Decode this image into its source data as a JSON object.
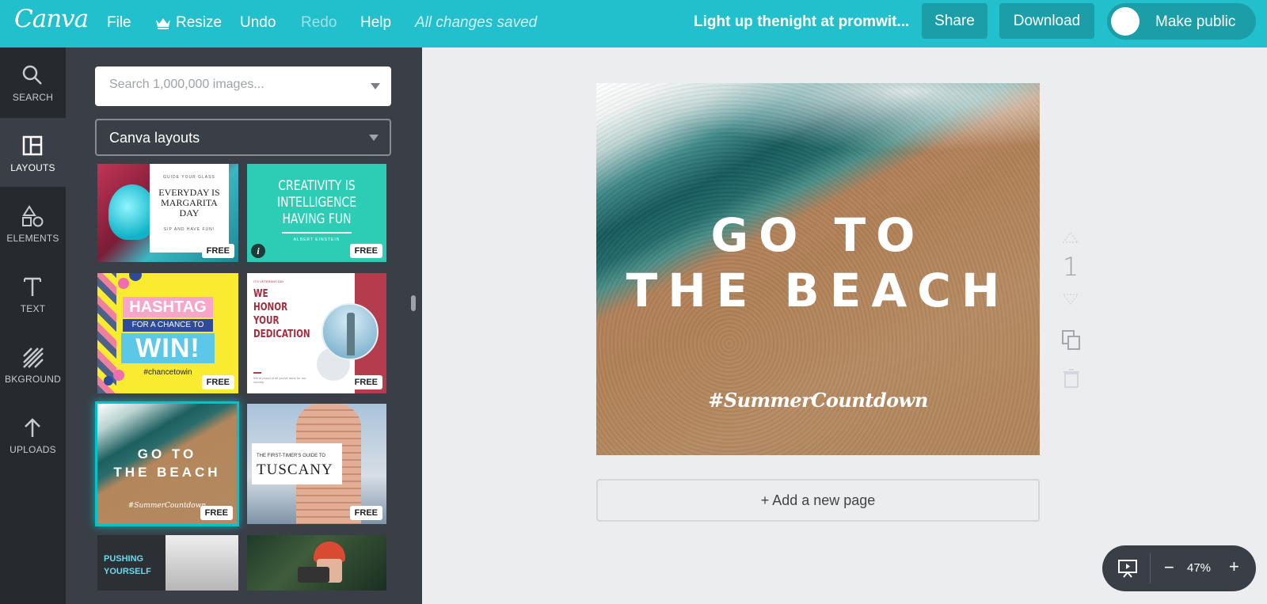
{
  "app": {
    "logo": "Canva"
  },
  "menu": {
    "file": "File",
    "resize": "Resize",
    "undo": "Undo",
    "redo": "Redo",
    "help": "Help",
    "save_status": "All changes saved"
  },
  "header": {
    "doc_title": "Light up thenight at promwit...",
    "share": "Share",
    "download": "Download",
    "make_public": "Make public"
  },
  "rail": {
    "search": "SEARCH",
    "layouts": "LAYOUTS",
    "elements": "ELEMENTS",
    "text": "TEXT",
    "background": "BKGROUND",
    "uploads": "UPLOADS"
  },
  "panel": {
    "search_placeholder": "Search 1,000,000 images...",
    "category": "Canva layouts",
    "free_badge": "FREE"
  },
  "thumbs": {
    "t1": {
      "top": "GUIDE YOUR GLASS",
      "main": "EVERYDAY IS MARGARITA DAY",
      "bottom": "SIP AND HAVE FUN!"
    },
    "t2": {
      "main": "CREATIVITY IS INTELLIGENCE HAVING FUN",
      "author": "ALBERT EINSTEIN",
      "info": "i"
    },
    "t3": {
      "hashtag": "HASHTAG",
      "chance": "FOR A CHANCE TO",
      "win": "WIN!",
      "tag": "#chancetowin"
    },
    "t4": {
      "small": "IT'S VETERANS DAY",
      "main": "WE HONOR YOUR DEDICATION",
      "foot": "We're proud of all you've done for our country"
    },
    "t5": {
      "line1": "GO TO",
      "line2": "THE BEACH",
      "tag": "#SummerCountdown"
    },
    "t6": {
      "small": "THE FIRST-TIMER'S GUIDE TO",
      "main": "TUSCANY"
    },
    "t7": {
      "text": "PUSHING YOURSELF"
    }
  },
  "canvas": {
    "title_line1": "GO TO",
    "title_line2": "THE BEACH",
    "hashtag": "#SummerCountdown",
    "page_number": "1",
    "add_page": "+ Add a new page"
  },
  "zoom": {
    "value": "47%",
    "minus": "−",
    "plus": "+"
  },
  "colors": {
    "brand_teal": "#22c0cc",
    "button_teal": "#1b9ea8",
    "rail_dark": "#26292e",
    "panel_gray": "#3a3f47",
    "workspace": "#ebedef"
  }
}
